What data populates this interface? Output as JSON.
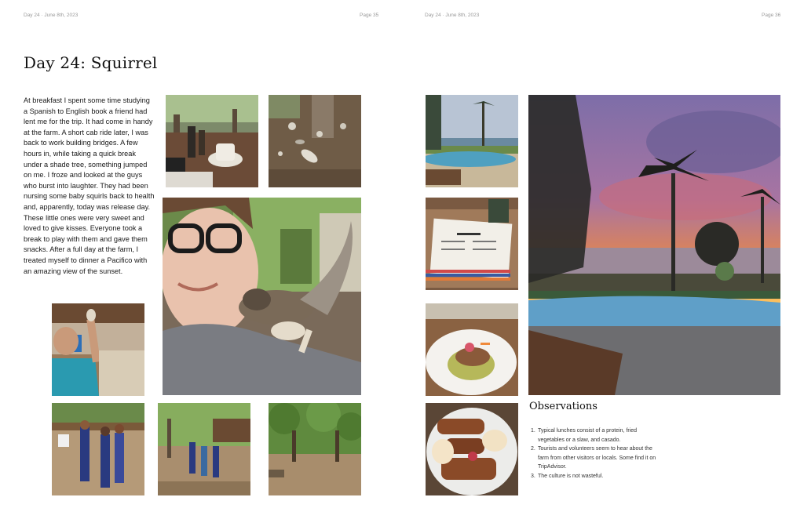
{
  "left_page": {
    "header_left": "Day 24 · June 8th, 2023",
    "header_right": "Page 35",
    "title": "Day 24: Squirrel",
    "body": "At breakfast I spent some time studying a Spanish to English book a friend had lent me for the trip. It had come in handy at the farm. A short cab ride later, I was back to work building bridges.  A few hours in, while taking a quick break under a shade tree, something jumped on me.  I froze and looked at the guys who burst into laughter.  They had been nursing some baby squirls back to health and, apparently, today was release day. These little ones were very sweet and loved to give kisses. Everyone took a break to play with them and gave them snacks.  After a full day at the farm, I treated myself to dinner a Pacifico with an amazing view of the sunset."
  },
  "right_page": {
    "header_left": "Day 24 · June 8th, 2023",
    "header_right": "Page 36",
    "observations_title": "Observations",
    "observations": [
      {
        "num": "1.",
        "text": "Typical lunches consist of a protein, fried vegetables or a slaw, and casado."
      },
      {
        "num": "2.",
        "text": "Tourists and volunteers seem to hear about the farm from other visitors or locals. Some find it on TripAdvisor."
      },
      {
        "num": "3.",
        "text": "The culture is not wasteful."
      }
    ]
  },
  "colors": {
    "sunset_sky": "#8a6fa3",
    "sunset_orange": "#f08a3c",
    "pool_blue": "#5f9fc8",
    "jungle_green": "#4f7a3a"
  }
}
